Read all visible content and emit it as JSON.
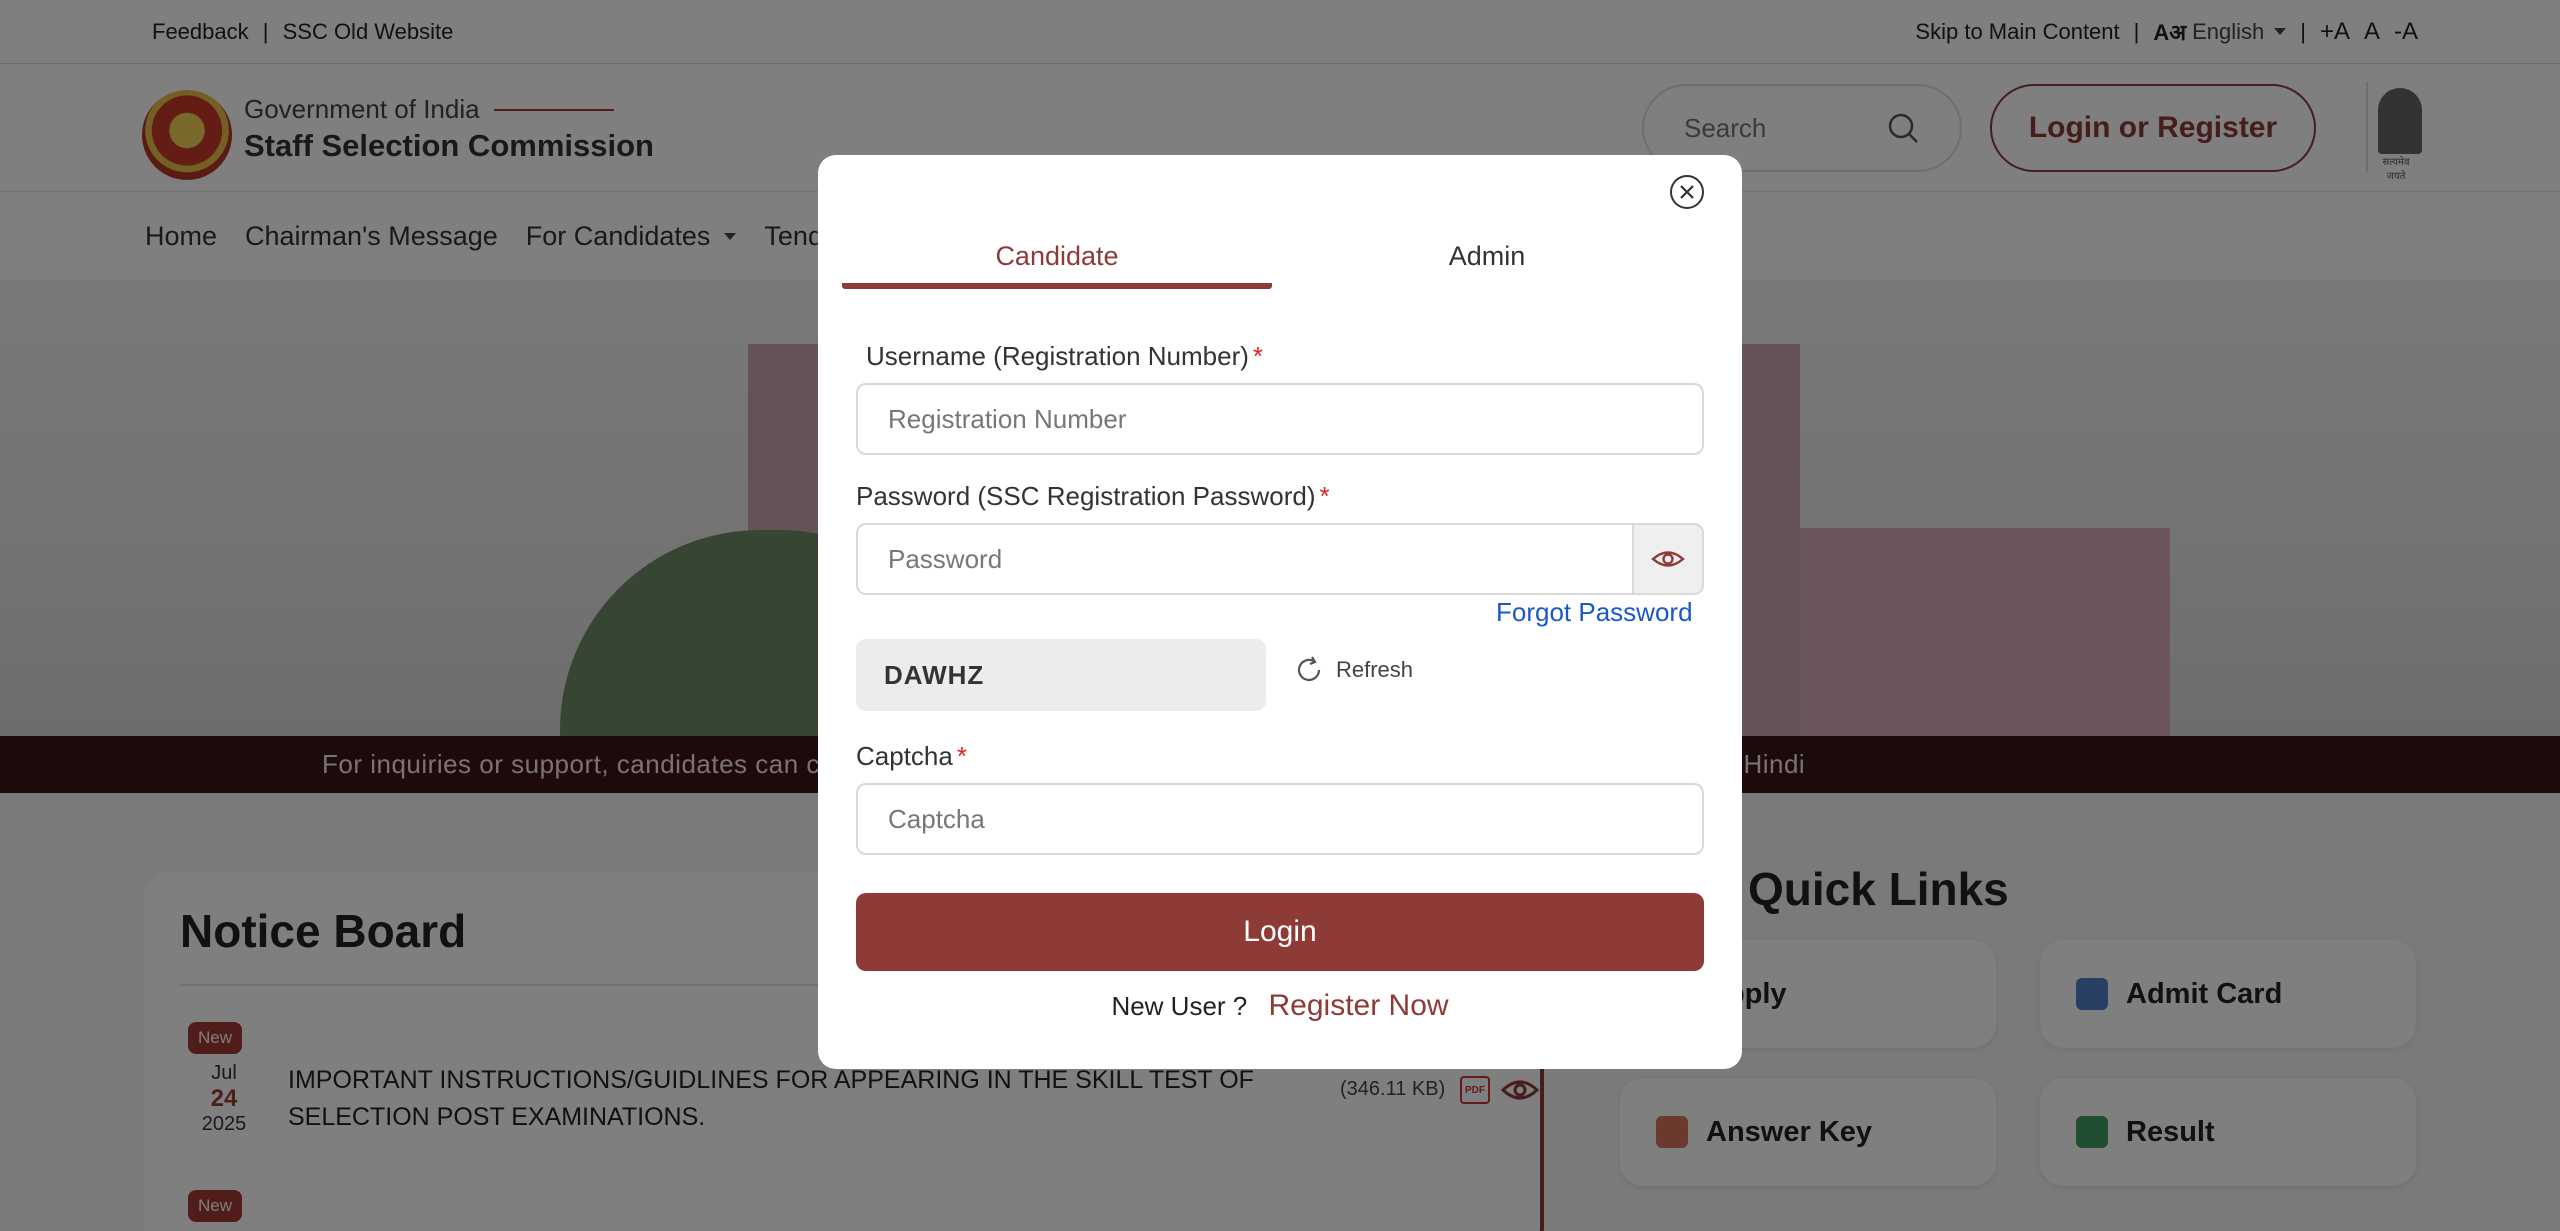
{
  "topbar": {
    "feedback": "Feedback",
    "old_site": "SSC Old Website",
    "skip": "Skip to Main Content",
    "lang_glyph": "Aअ",
    "language": "English",
    "font_increase": "+A",
    "font_normal": "A",
    "font_decrease": "-A"
  },
  "header": {
    "org_sub": "Government of India",
    "org_title": "Staff Selection Commission",
    "search_placeholder": "Search",
    "login_register": "Login or Register",
    "emblem_text": "सत्यमेव जयते"
  },
  "nav": {
    "items": [
      "Home",
      "Chairman's Message",
      "For Candidates",
      "Tende"
    ]
  },
  "ticker": {
    "text": "For inquiries or support, candidates can call the toll-free number 1800-309-3063 - Languages Supported : English and Hindi"
  },
  "notice_board": {
    "title": "Notice Board",
    "items": [
      {
        "badge": "New",
        "month": "Jul",
        "day": "24",
        "year": "2025",
        "text": "IMPORTANT INSTRUCTIONS/GUIDLINES FOR APPEARING IN THE SKILL TEST OF SELECTION POST EXAMINATIONS.",
        "size": "(346.11 KB)",
        "file_type": "PDF"
      },
      {
        "badge": "New"
      }
    ]
  },
  "quick_links": {
    "title": "Quick Links",
    "items": [
      {
        "label": "Apply",
        "icon": "apply-icon"
      },
      {
        "label": "Admit Card",
        "icon": "admit-card-icon"
      },
      {
        "label": "Answer Key",
        "icon": "answer-key-icon"
      },
      {
        "label": "Result",
        "icon": "result-icon"
      }
    ]
  },
  "modal": {
    "tabs": [
      {
        "label": "Candidate",
        "active": true
      },
      {
        "label": "Admin",
        "active": false
      }
    ],
    "username_label": "Username (Registration Number)",
    "username_placeholder": "Registration Number",
    "password_label": "Password (SSC Registration Password)",
    "password_placeholder": "Password",
    "required_mark": "*",
    "forgot_password": "Forgot Password",
    "captcha_code": "DAWHZ",
    "refresh": "Refresh",
    "captcha_label": "Captcha",
    "captcha_placeholder": "Captcha",
    "login_button": "Login",
    "new_user": "New User ?",
    "register_now": "Register Now"
  },
  "colors": {
    "brand": "#8e3a37",
    "link": "#1a59c9",
    "ticker_bg": "#3a1717",
    "required": "#dd2222"
  }
}
